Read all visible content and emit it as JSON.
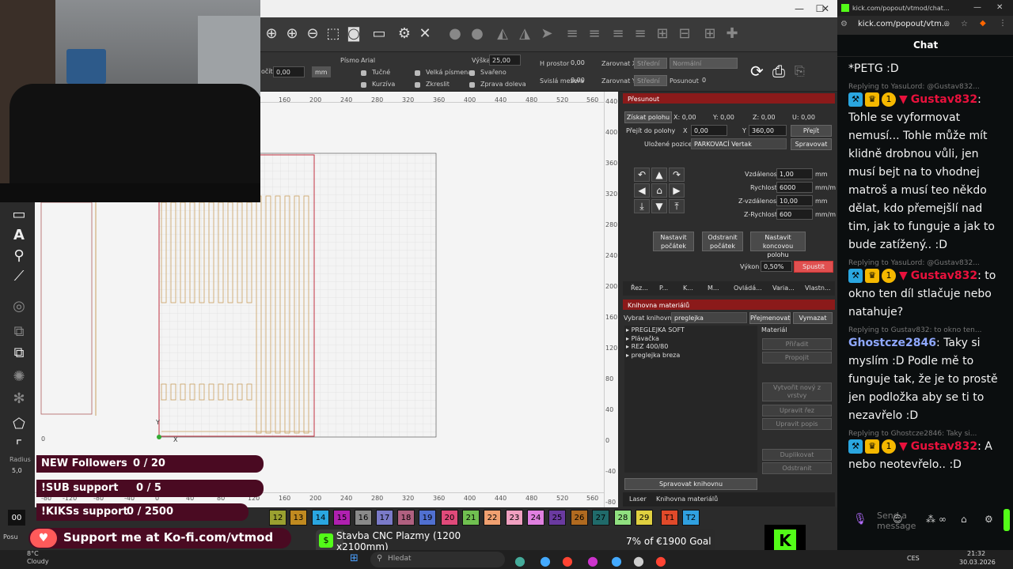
{
  "lightburn": {
    "window_controls": [
      "—",
      "☐",
      "✕"
    ],
    "text_toolbar": {
      "pocet_label": "očít",
      "pocet_value": "0,00",
      "unit": "mm",
      "font_label": "Písmo",
      "font_value": "Arial",
      "height_label": "Výška",
      "height_value": "25,00",
      "hspace_label": "H prostor",
      "hspace_value": "0,00",
      "vspace_label": "Svislá mezera",
      "vspace_value": "0,00",
      "align_x_label": "Zarovnat X",
      "align_x_value": "Střední",
      "align_y_label": "Zarovnat Y",
      "align_y_value": "Střední",
      "normal_value": "Normální",
      "offset_label": "Posunout",
      "offset_value": "0",
      "bold": "Tučné",
      "italic": "Kurzíva",
      "upper": "Velká písmena",
      "distort": "Zkreslit",
      "welded": "Svařeno",
      "mirror": "Zprava doleva"
    },
    "ruler_top": [
      "160",
      "200",
      "240",
      "280",
      "320",
      "360",
      "400",
      "440",
      "480",
      "520",
      "560"
    ],
    "ruler_right": [
      "440",
      "400",
      "360",
      "320",
      "280",
      "240",
      "200",
      "160",
      "120",
      "80",
      "40",
      "0",
      "-40",
      "-80"
    ],
    "ruler_bottom": [
      "-80",
      "-120",
      "-80",
      "-40",
      "0",
      "40",
      "80",
      "120",
      "160",
      "200",
      "240",
      "280",
      "320",
      "360",
      "400",
      "440",
      "480",
      "520",
      "560"
    ],
    "left_ruler_label": "0",
    "axis_labels": {
      "y": "Y",
      "x": "X"
    },
    "left_tools_footer": {
      "radius_label": "Radius",
      "radius_value": "5,0"
    },
    "move_panel": {
      "title": "Přesunout",
      "get_position": "Získat polohu",
      "coords": [
        "X: 0,00",
        "Y: 0,00",
        "Z: 0,00",
        "U: 0,00"
      ],
      "goto_label": "Přejít do polohy",
      "goto_x_label": "X",
      "goto_x": "0,00",
      "goto_y_label": "Y",
      "goto_y": "360,00",
      "goto_button": "Přejít",
      "saved_label": "Uložené pozice:",
      "saved_value": "PARKOVACÍ Vertak",
      "manage_button": "Spravovat",
      "distance_label": "Vzdálenost",
      "distance_value": "1,00",
      "distance_unit": "mm",
      "speed_label": "Rychlost",
      "speed_value": "6000",
      "speed_unit": "mm/m",
      "zdist_label": "Z-vzdálenost",
      "zdist_value": "10,00",
      "zdist_unit": "mm",
      "zspeed_label": "Z-Rychlost",
      "zspeed_value": "600",
      "zspeed_unit": "mm/m",
      "set_origin": "Nastavit počátek",
      "remove_origin": "Odstranit počátek",
      "set_end": "Nastavit koncovou polohu",
      "power_label": "Výkon",
      "power_value": "0,50%",
      "fire_button": "Spustit"
    },
    "panel_tabs": [
      "Řez...",
      "P...",
      "K...",
      "M...",
      "Ovládá...",
      "Varia...",
      "Vlastn..."
    ],
    "material_panel": {
      "title": "Knihovna materiálů",
      "select_label": "Vybrat knihovnu",
      "select_value": "preglejka",
      "rename_button": "Přejmenovat",
      "delete_button": "Vymazat",
      "tree": [
        "PREGLEJKA SOFT",
        "Plávačka",
        "REZ 400/80",
        "preglejka breza"
      ],
      "material_label": "Materiál",
      "assign": "Přiřadit",
      "link": "Propojit",
      "create_new": "Vytvořit nový z vrstvy",
      "edit_cut": "Upravit řez",
      "edit_desc": "Upravit popis",
      "duplicate": "Duplikovat",
      "remove": "Odstranit",
      "manage_library": "Spravovat knihovnu"
    },
    "bottom_tabs": [
      "Laser",
      "Knihovna materiálů"
    ],
    "palette": [
      {
        "label": "00",
        "color": "#111111",
        "text": "#ffffff"
      },
      {
        "label": "12",
        "color": "#9aa030"
      },
      {
        "label": "13",
        "color": "#c08a20"
      },
      {
        "label": "14",
        "color": "#2aa6e0"
      },
      {
        "label": "15",
        "color": "#b020b0"
      },
      {
        "label": "16",
        "color": "#8a8a8a"
      },
      {
        "label": "17",
        "color": "#7a7ac8"
      },
      {
        "label": "18",
        "color": "#b06080"
      },
      {
        "label": "19",
        "color": "#5070d0"
      },
      {
        "label": "20",
        "color": "#e04a7a"
      },
      {
        "label": "21",
        "color": "#70c050"
      },
      {
        "label": "22",
        "color": "#f0a070"
      },
      {
        "label": "23",
        "color": "#f0a0c0"
      },
      {
        "label": "24",
        "color": "#e080e0"
      },
      {
        "label": "25",
        "color": "#6a3aa0"
      },
      {
        "label": "26",
        "color": "#b06a20"
      },
      {
        "label": "27",
        "color": "#206a6a"
      },
      {
        "label": "28",
        "color": "#90e080"
      },
      {
        "label": "29",
        "color": "#e0d040"
      },
      {
        "label": "T1",
        "color": "#e04a2a"
      },
      {
        "label": "T2",
        "color": "#30a0e0"
      }
    ],
    "status_left": "Posu"
  },
  "overlay": {
    "followers_label": "NEW Followers",
    "followers_value": "0 / 20",
    "sub_label": "!SUB support",
    "sub_value": "0 / 5",
    "kiks_label": "!KIKSs support",
    "kiks_value": "0 / 2500",
    "kofi": "Support me at Ko-fi.com/vtmod",
    "goal_title": "Stavba CNC Plazmy (1200 x2100mm)",
    "goal_progress": "7% of €1900 Goal",
    "goal_fraction": 0.07
  },
  "taskbar": {
    "weather_temp": "8°C",
    "weather_desc": "Cloudy",
    "search_placeholder": "Hledat",
    "lang": "CES",
    "time": "21:32",
    "date": "30.03.2026"
  },
  "browser": {
    "tab_title": "kick.com/popout/vtmod/chat...",
    "address": "kick.com/popout/vtm...",
    "chat_header": "Chat",
    "send_placeholder": "Send a message",
    "messages": [
      {
        "kind": "plain",
        "text": "*PETG :D"
      },
      {
        "kind": "reply",
        "reply": "Replying to YasuLord: @Gustav832...",
        "user": "Gustav832",
        "user_color": "#e9113c",
        "badges": true,
        "text": "Tohle se vyformovat nemusí... Tohle může mít klidně drobnou vůli, jen musí bejt na to vhodnej matroš a musí teo někdo dělat, kdo přemejšlí nad tim, jak to funguje a jak to bude zatížený.. :D"
      },
      {
        "kind": "reply",
        "reply": "Replying to YasuLord: @Gustav832...",
        "user": "Gustav832",
        "user_color": "#e9113c",
        "badges": true,
        "text": "to okno ten díl stlačuje nebo natahuje?"
      },
      {
        "kind": "reply",
        "reply": "Replying to Gustav832: to okno ten...",
        "user": "Ghostcze2846",
        "user_color": "#8fa8ff",
        "badges": false,
        "text": "Taky si myslím :D Podle mě to funguje tak, že je to prostě jen podložka aby se ti to nezavřelo :D"
      },
      {
        "kind": "reply",
        "reply": "Replying to Ghostcze2846: Taky si...",
        "user": "Gustav832",
        "user_color": "#e9113c",
        "badges": true,
        "text": "A nebo neotevřelo.. :D"
      }
    ]
  }
}
